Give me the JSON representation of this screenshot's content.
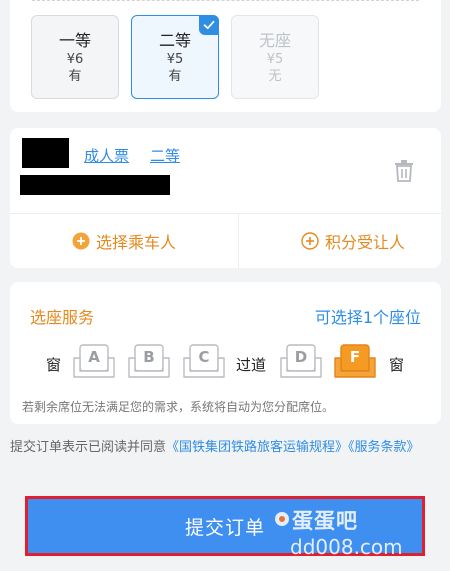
{
  "seat_classes": [
    {
      "name": "一等",
      "price": "¥6",
      "availability": "有",
      "state": "normal"
    },
    {
      "name": "二等",
      "price": "¥5",
      "availability": "有",
      "state": "selected"
    },
    {
      "name": "无座",
      "price": "¥5",
      "availability": "无",
      "state": "disabled"
    }
  ],
  "passenger": {
    "ticket_type": "成人票",
    "seat_class": "二等",
    "actions": {
      "select_passenger": "选择乘车人",
      "points_transfer": "积分受让人"
    }
  },
  "seat_selection": {
    "title": "选座服务",
    "count_text": "可选择1个座位",
    "window_label_left": "窗",
    "aisle_label": "过道",
    "window_label_right": "窗",
    "seats": [
      {
        "letter": "A",
        "selected": false
      },
      {
        "letter": "B",
        "selected": false
      },
      {
        "letter": "C",
        "selected": false
      },
      {
        "letter": "D",
        "selected": false
      },
      {
        "letter": "F",
        "selected": true
      }
    ],
    "note": "若剩余席位无法满足您的需求，系统将自动为您分配席位。"
  },
  "agreement": {
    "prefix": "提交订单表示已阅读并同意",
    "link1": "《国铁集团铁路旅客运输规程》",
    "link2": "《服务条款》"
  },
  "submit_label": "提交订单",
  "watermark": {
    "name": "蛋蛋吧",
    "domain": "dd008.com"
  },
  "colors": {
    "accent_blue": "#2f8de4",
    "accent_orange": "#e48a20",
    "highlight": "#e0202e"
  }
}
